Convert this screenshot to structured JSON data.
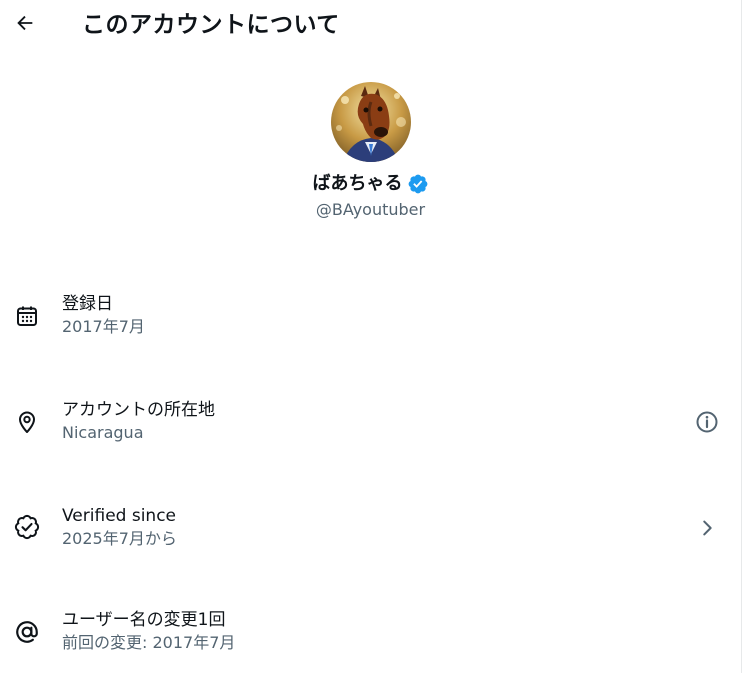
{
  "header": {
    "title": "このアカウントについて",
    "back_icon": "arrow-left-icon"
  },
  "profile": {
    "display_name": "ばあちゃる",
    "handle": "@BAyoutuber",
    "verified": true,
    "avatar": "horse-mask-avatar"
  },
  "rows": [
    {
      "label": "登録日",
      "value": "2017年7月",
      "icon": "calendar-icon"
    },
    {
      "label": "アカウントの所在地",
      "value": "Nicaragua",
      "icon": "location-pin-icon",
      "action_icon": "info-icon"
    },
    {
      "label": "Verified since",
      "value": "2025年7月から",
      "icon": "verified-badge-outline-icon",
      "action_icon": "chevron-right-icon"
    },
    {
      "label": "ユーザー名の変更1回",
      "value": "前回の変更: 2017年7月",
      "icon": "at-sign-icon"
    }
  ],
  "colors": {
    "text_primary": "#0f1419",
    "text_secondary": "#536471",
    "verified_blue": "#1d9bf0"
  }
}
